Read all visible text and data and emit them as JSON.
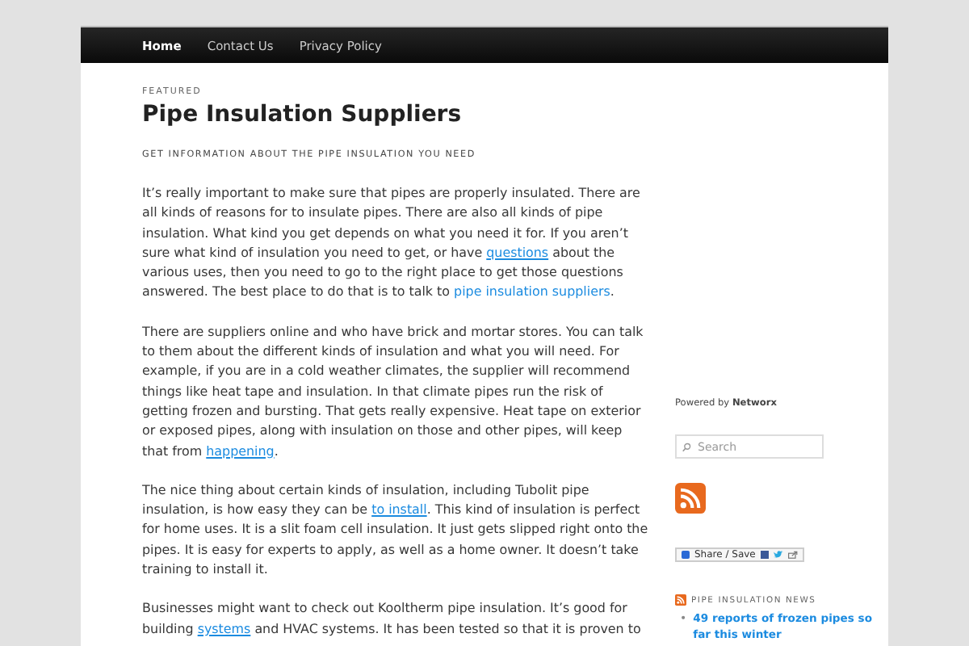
{
  "nav": {
    "items": [
      {
        "label": "Home",
        "selected": true
      },
      {
        "label": "Contact Us",
        "selected": false
      },
      {
        "label": "Privacy Policy",
        "selected": false
      }
    ]
  },
  "post": {
    "kicker": "FEATURED",
    "title": "Pipe Insulation Suppliers",
    "subtitle": "GET INFORMATION ABOUT THE PIPE INSULATION YOU NEED",
    "paragraphs": [
      [
        {
          "kind": "text",
          "text": "It’s really important to make sure that pipes are properly insulated. There are all kinds of reasons for to insulate pipes. There are also all kinds of pipe insulation. What kind you get depends on what you need it for. If you aren’t sure what kind of insulation you need to get, or have "
        },
        {
          "kind": "link",
          "text": "questions",
          "underline": true
        },
        {
          "kind": "text",
          "text": " about the various uses, then you need to go to the right place to get those questions answered. The best place to do that is to talk to "
        },
        {
          "kind": "link",
          "text": "pipe insulation suppliers",
          "underline": false
        },
        {
          "kind": "text",
          "text": "."
        }
      ],
      [
        {
          "kind": "text",
          "text": "There are suppliers online and who have brick and mortar stores. You can talk to them about the different kinds of insulation and what you will need. For example, if you are in a cold weather climates, the supplier will recommend things like heat tape and insulation. In that climate pipes run the risk of getting frozen and bursting. That gets really expensive. Heat tape on exterior or exposed pipes, along with insulation on those and other pipes, will keep that from "
        },
        {
          "kind": "link",
          "text": "happening",
          "underline": true
        },
        {
          "kind": "text",
          "text": "."
        }
      ],
      [
        {
          "kind": "text",
          "text": "The nice thing about certain kinds of insulation, including Tubolit pipe insulation, is how easy they can be "
        },
        {
          "kind": "link",
          "text": "to install",
          "underline": true
        },
        {
          "kind": "text",
          "text": ". This kind of insulation is perfect for home uses. It is a slit foam cell insulation. It just gets slipped right onto the pipes. It is easy for experts to apply, as well as a home owner. It doesn’t take training to install it."
        }
      ],
      [
        {
          "kind": "text",
          "text": "Businesses might want to check out Kooltherm pipe insulation. It’s good for building "
        },
        {
          "kind": "link",
          "text": "systems",
          "underline": true
        },
        {
          "kind": "text",
          "text": " and HVAC systems. It has been tested so that it is proven to"
        }
      ]
    ]
  },
  "sidebar": {
    "powered_by": "Powered by **Networx**",
    "search": {
      "placeholder": "Search"
    },
    "share_button": "Share / Save",
    "news": {
      "heading": "PIPE INSULATION NEWS",
      "items": [
        {
          "bullet": "•",
          "text": "49 reports of frozen pipes so far this winter"
        }
      ]
    }
  }
}
